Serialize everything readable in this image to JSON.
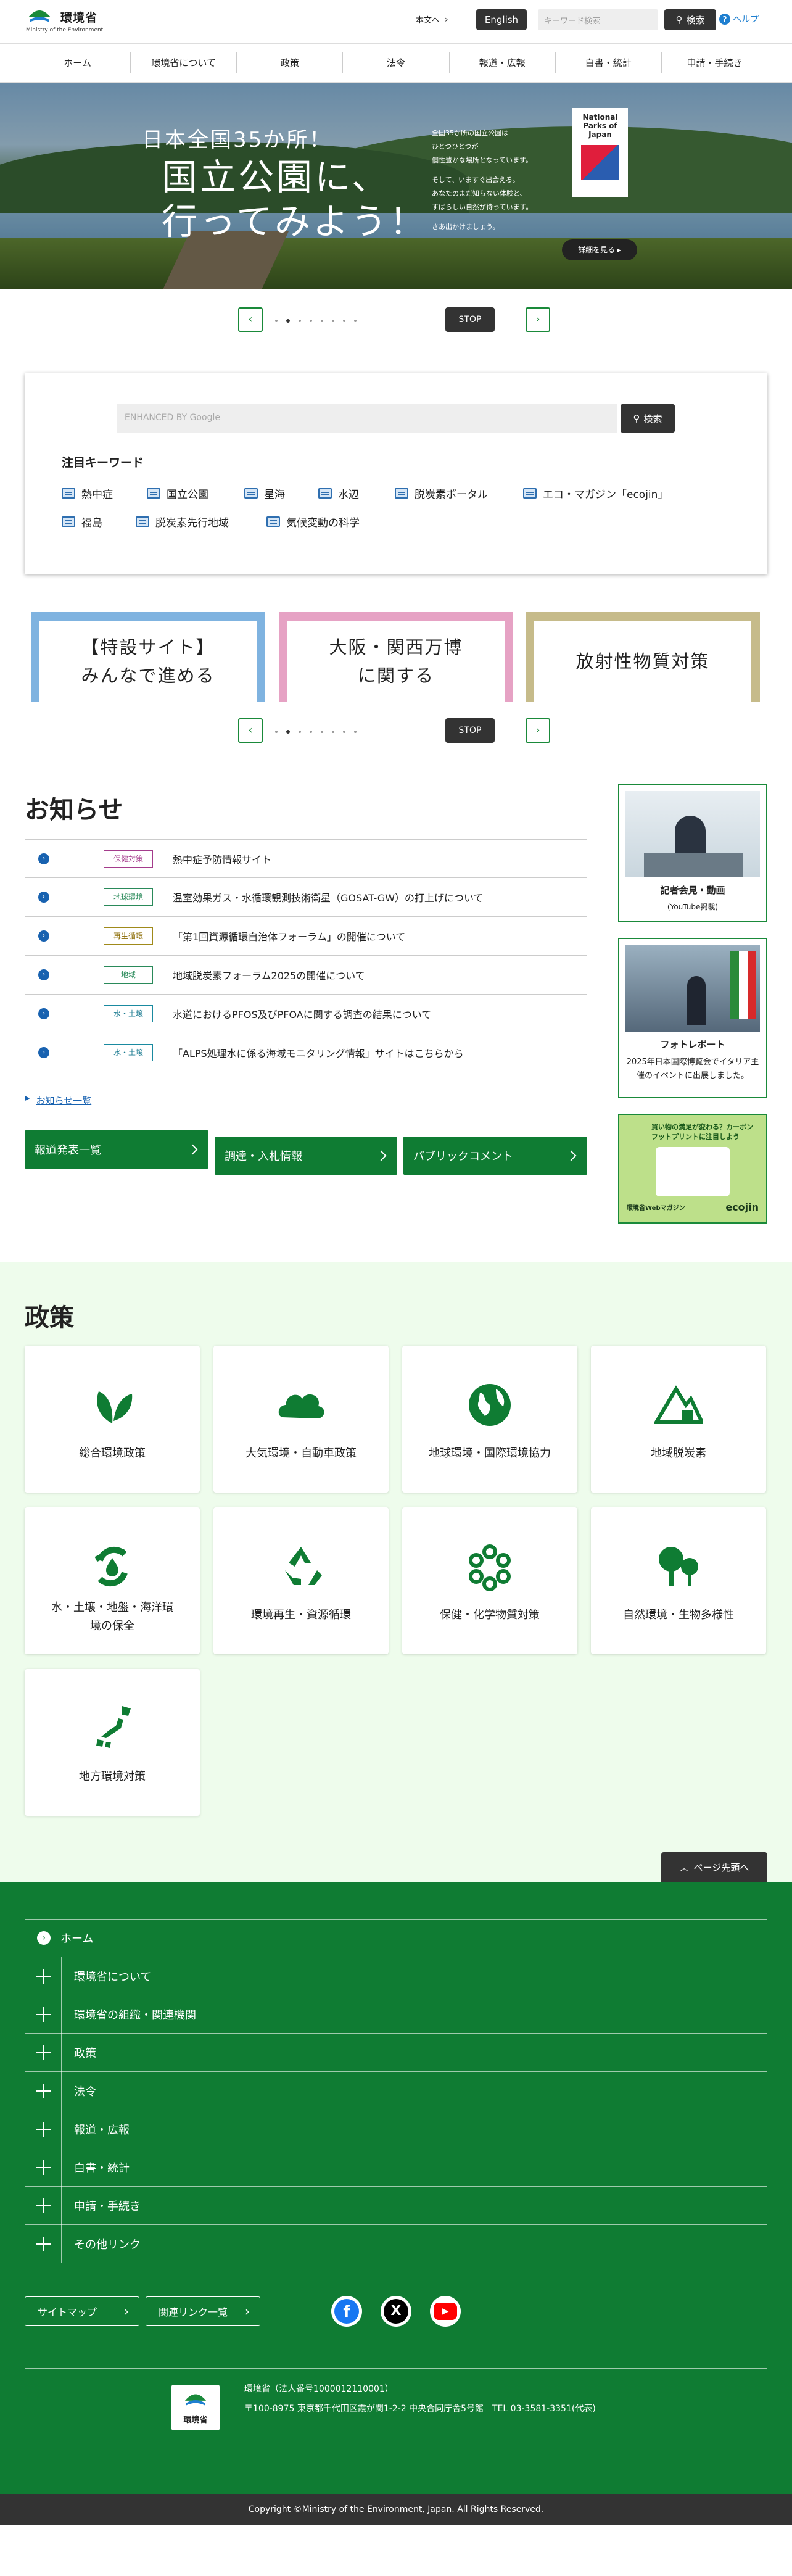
{
  "header": {
    "logo_name": "環境省",
    "logo_en": "Ministry of the Environment",
    "skip_label": "本文へ",
    "english_label": "English",
    "search_placeholder": "キーワード検索",
    "search_button": "検索",
    "help_label": "ヘルプ"
  },
  "nav": [
    "ホーム",
    "環境省について",
    "政策",
    "法令",
    "報道・広報",
    "白書・統計",
    "申請・手続き"
  ],
  "hero": {
    "line1": "日本全国35か所！",
    "line2a": "国立公園に、",
    "line2b": "行ってみよう！",
    "body": [
      "全国35か所の国立公園は",
      "ひとつひとつが",
      "個性豊かな場所となっています。",
      "",
      "そして、いますぐ出会える。",
      "あなたのまだ知らない体験と、",
      "すばらしい自然が待っています。",
      "",
      "さあ出かけましょう。"
    ],
    "badge": "National Parks of Japan",
    "more_label": "詳細を見る"
  },
  "carousel_stop": "STOP",
  "google": {
    "placeholder": "ENHANCED BY Google",
    "button": "検索",
    "title": "注目キーワード",
    "keywords_row1": [
      "熱中症",
      "国立公園",
      "星海",
      "水辺",
      "脱炭素ポータル",
      "エコ・マガジン「ecojin」"
    ],
    "keywords_row2": [
      "福島",
      "脱炭素先行地域",
      "気候変動の科学"
    ]
  },
  "banners": [
    {
      "line1": "【特設サイト】",
      "line2": "みんなで進める"
    },
    {
      "line1": "大阪・関西万博",
      "line2": "に関する"
    },
    {
      "line1": "放射性物質対策",
      "line2": ""
    }
  ],
  "news": {
    "title": "お知らせ",
    "items": [
      {
        "tag": "保健対策",
        "text": "熱中症予防情報サイト"
      },
      {
        "tag": "地球環境",
        "text": "温室効果ガス・水循環観測技術衛星（GOSAT-GW）の打上げについて"
      },
      {
        "tag": "再生循環",
        "text": "「第1回資源循環自治体フォーラム」の開催について"
      },
      {
        "tag": "地域",
        "text": "地域脱炭素フォーラム2025の開催について"
      },
      {
        "tag": "水・土壌",
        "text": "水道におけるPFOS及びPFOAに関する調査の結果について"
      },
      {
        "tag": "水・土壌",
        "text": "「ALPS処理水に係る海域モニタリング情報」サイトはこちらから"
      }
    ],
    "list_link": "お知らせ一覧",
    "buttons": [
      "報道発表一覧",
      "調達・入札情報",
      "パブリックコメント"
    ]
  },
  "sidebar": {
    "video_title": "記者会見・動画",
    "video_sub": "(YouTube掲載)",
    "photo_title": "フォトレポート",
    "photo_text": "2025年日本国際博覧会でイタリア主催のイベントに出展しました。",
    "eco_text": "買い物の満足が変わる？カーボンフットプリントに注目しよう",
    "eco_foot": "環境省Webマガジン",
    "eco_logo": "ecojin"
  },
  "policy": {
    "title": "政策",
    "items": [
      "総合環境政策",
      "大気環境・自動車政策",
      "地球環境・国際環境協力",
      "地域脱炭素",
      "水・土壌・地盤・海洋環境の保全",
      "環境再生・資源循環",
      "保健・化学物質対策",
      "自然環境・生物多様性",
      "地方環境対策"
    ]
  },
  "page_top": "ページ先頭へ",
  "footer": {
    "home": "ホーム",
    "menu": [
      "環境省について",
      "環境省の組織・関連機関",
      "政策",
      "法令",
      "報道・広報",
      "白書・統計",
      "申請・手続き",
      "その他リンク"
    ],
    "sitemap": "サイトマップ",
    "related": "関連リンク一覧",
    "org": "環境省（法人番号1000012110001）",
    "address": "〒100-8975 東京都千代田区霞が関1-2-2 中央合同庁舎5号館　TEL 03-3581-3351(代表)",
    "copyright": "Copyright ©Ministry of the Environment, Japan. All Rights Reserved."
  },
  "colors": {
    "green": "#0f7c33",
    "light_green_bg": "#eefcec",
    "dark": "#333333"
  }
}
